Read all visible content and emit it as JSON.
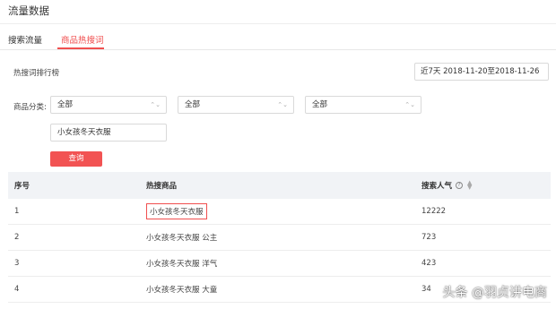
{
  "page": {
    "title": "流量数据"
  },
  "tabs": [
    {
      "label": "搜索流量",
      "active": false
    },
    {
      "label": "商品热搜词",
      "active": true
    }
  ],
  "ranking": {
    "label": "热搜词排行榜",
    "date_range": "近7天 2018-11-20至2018-11-26"
  },
  "filters": {
    "category_label": "商品分类:",
    "selects": [
      "全部",
      "全部",
      "全部"
    ],
    "keyword_value": "小女孩冬天衣服",
    "query_button": "查询"
  },
  "table": {
    "headers": {
      "rank": "序号",
      "product": "热搜商品",
      "popularity": "搜索人气"
    },
    "rows": [
      {
        "rank": "1",
        "product": "小女孩冬天衣服",
        "popularity": "12222"
      },
      {
        "rank": "2",
        "product": "小女孩冬天衣服 公主",
        "popularity": "723"
      },
      {
        "rank": "3",
        "product": "小女孩冬天衣服 洋气",
        "popularity": "423"
      },
      {
        "rank": "4",
        "product": "小女孩冬天衣服 大童",
        "popularity": "34"
      }
    ]
  },
  "watermark": "头条 @羽贞讲电商",
  "colors": {
    "accent": "#f04f4f",
    "button": "#f25353",
    "header_bg": "#f1f3f6"
  }
}
